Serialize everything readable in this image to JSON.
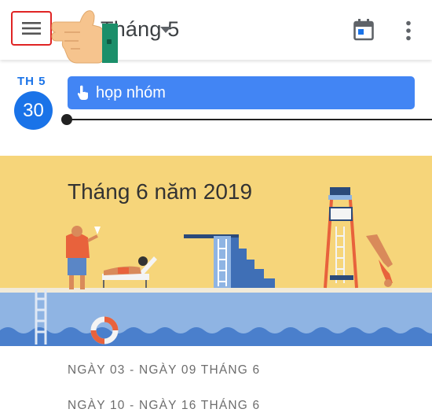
{
  "header": {
    "month_title": "Tháng 5",
    "menu_icon": "hamburger-menu-icon",
    "today_icon": "calendar-today-icon",
    "more_icon": "more-vert-icon",
    "highlight_color": "#e02424"
  },
  "day": {
    "abbr": "TH 5",
    "number": "30",
    "accent": "#1a73e8"
  },
  "event": {
    "title": "họp nhóm",
    "color": "#4285f4",
    "icon": "hand-pointer-icon"
  },
  "banner": {
    "title": "Tháng 6 năm 2019",
    "background": "#f6d57a",
    "water": "#8fb4e3"
  },
  "weeks": [
    {
      "label": "NGÀY 03 - NGÀY 09 THÁNG 6"
    },
    {
      "label": "NGÀY 10 - NGÀY 16 THÁNG 6"
    }
  ]
}
